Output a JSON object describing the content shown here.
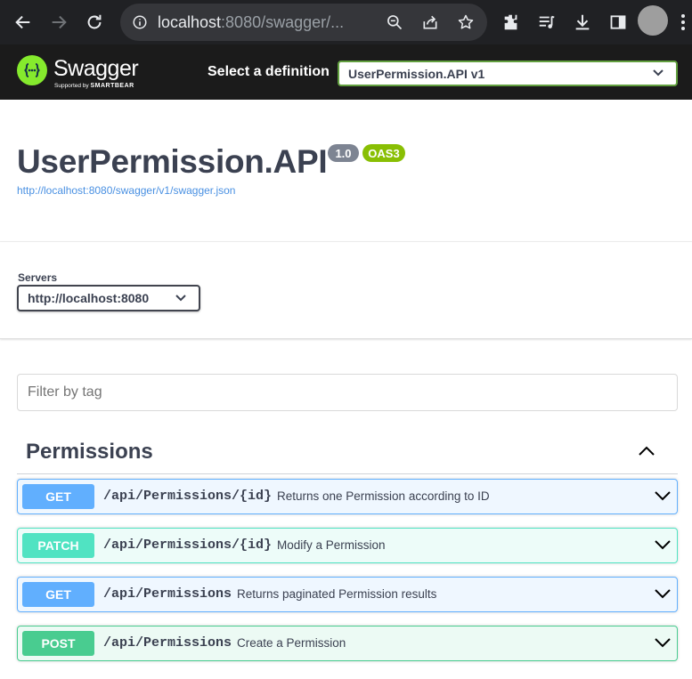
{
  "browser": {
    "url_host": "localhost",
    "url_rest": ":8080/swagger/..."
  },
  "topbar": {
    "logo_name": "Swagger",
    "logo_supported": "Supported by",
    "logo_brand": "SMARTBEAR",
    "definition_label": "Select a definition",
    "definition_value": "UserPermission.API v1"
  },
  "info": {
    "title": "UserPermission.API",
    "version": "1.0",
    "oas": "OAS3",
    "spec_url": "http://localhost:8080/swagger/v1/swagger.json"
  },
  "servers": {
    "label": "Servers",
    "selected": "http://localhost:8080"
  },
  "filter": {
    "placeholder": "Filter by tag"
  },
  "tag": {
    "name": "Permissions",
    "operations": [
      {
        "method": "GET",
        "path": "/api/Permissions/{id}",
        "summary": "Returns one Permission according to ID"
      },
      {
        "method": "PATCH",
        "path": "/api/Permissions/{id}",
        "summary": "Modify a Permission"
      },
      {
        "method": "GET",
        "path": "/api/Permissions",
        "summary": "Returns paginated Permission results"
      },
      {
        "method": "POST",
        "path": "/api/Permissions",
        "summary": "Create a Permission"
      }
    ]
  },
  "colors": {
    "get": "#61affe",
    "patch": "#50e3c2",
    "post": "#49cc90",
    "swagger_green": "#85ea2d",
    "text": "#3b4151"
  }
}
